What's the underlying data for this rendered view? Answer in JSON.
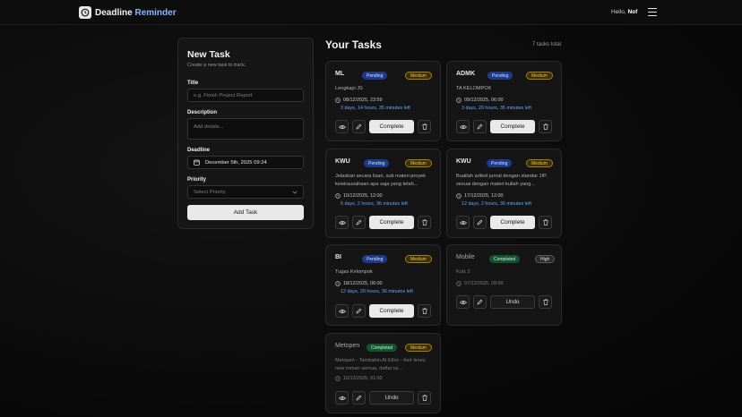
{
  "app": {
    "name_main": "Deadline",
    "name_accent": "Reminder",
    "greeting_prefix": "Hello,",
    "user": "Nof"
  },
  "new_task": {
    "title": "New Task",
    "subtitle": "Create a new task to track.",
    "title_label": "Title",
    "title_placeholder": "e.g. Finish Project Report",
    "description_label": "Description",
    "description_placeholder": "Add details...",
    "deadline_label": "Deadline",
    "deadline_value": "December 5th, 2025 09:24",
    "priority_label": "Priority",
    "priority_value": "Select Priority",
    "add_button": "Add Task"
  },
  "tasks_header": {
    "title": "Your Tasks",
    "total": "7 tasks total"
  },
  "tasks": [
    {
      "name": "ML",
      "status": "Pending",
      "priority": "Medium",
      "description": "Lengkapi JS",
      "date": "08/12/2025, 23:59",
      "time_left": "3 days, 14 hours, 35 minutes left",
      "action": "Complete"
    },
    {
      "name": "ADMK",
      "status": "Pending",
      "priority": "Medium",
      "description": "TA KELOMPOK",
      "date": "09/12/2025, 06:00",
      "time_left": "3 days, 20 hours, 35 minutes left",
      "action": "Complete"
    },
    {
      "name": "KWU",
      "status": "Pending",
      "priority": "Medium",
      "description": "Jelaskan secara lisan, sub materi proyek kewirausahaan apa saja yang telah...",
      "date": "10/12/2025, 12:00",
      "time_left": "5 days, 2 hours, 36 minutes left",
      "action": "Complete"
    },
    {
      "name": "KWU",
      "status": "Pending",
      "priority": "Medium",
      "description": "Buatlah artikel jurnal dengan standar JIP. sesuai dengan materi kuliah yang...",
      "date": "17/12/2025, 12:00",
      "time_left": "12 days, 2 hours, 36 minutes left",
      "action": "Complete"
    },
    {
      "name": "BI",
      "status": "Pending",
      "priority": "Medium",
      "description": "Tugas Kelompok",
      "date": "18/12/2025, 06:00",
      "time_left": "12 days, 20 hours, 36 minutes left",
      "action": "Complete"
    },
    {
      "name": "Mobile",
      "status": "Completed",
      "priority": "High",
      "description": "Kuis 2",
      "date": "07/12/2025, 09:00",
      "time_left": "",
      "action": "Undo"
    },
    {
      "name": "Metopen",
      "status": "Completed",
      "priority": "Medium",
      "description": "Metopen - Tambahin AI Ethic - font times new roman semua, daftar isi...",
      "date": "10/12/2025, 01:00",
      "time_left": "",
      "action": "Undo"
    }
  ],
  "colors": {
    "pending": "#1f3a8a",
    "completed": "#14532d",
    "medium": "#f5c542",
    "time_left": "#5fa8ff",
    "brand_accent": "#8ab4ff"
  }
}
